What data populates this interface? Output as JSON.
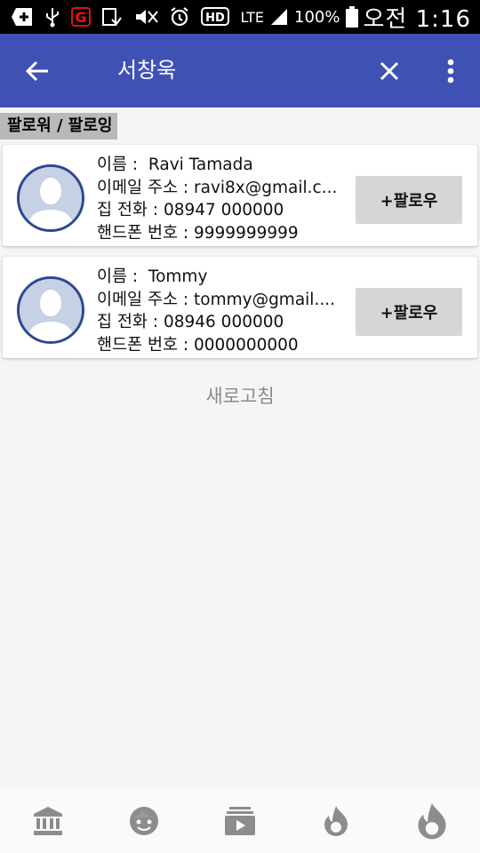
{
  "status_bar": {
    "network": "LTE",
    "battery": "100%",
    "time": "오전 1:16",
    "hd_label": "HD"
  },
  "app_bar": {
    "title": "서창욱"
  },
  "section_label": "팔로워 / 팔로잉",
  "users": [
    {
      "name_label": "이름 :",
      "name": "Ravi Tamada",
      "email_label": "이메일 주소 :",
      "email": "ravi8x@gmail.c...",
      "home_label": "집 전화 :",
      "home": "08947 000000",
      "mobile_label": "핸드폰 번호 :",
      "mobile": "9999999999",
      "button_label": "+팔로우"
    },
    {
      "name_label": "이름 :",
      "name": "Tommy",
      "email_label": "이메일 주소 :",
      "email": "tommy@gmail....",
      "home_label": "집 전화 :",
      "home": "08946 000000",
      "mobile_label": "핸드폰 번호 :",
      "mobile": "0000000000",
      "button_label": "+팔로우"
    }
  ],
  "refresh_label": "새로고침",
  "colors": {
    "app_bar": "#3f51b5",
    "avatar_border": "#2f4791",
    "button_bg": "#d6d6d6",
    "nav_icon": "#8c8c8c"
  },
  "bottom_nav": [
    "bank-icon",
    "face-icon",
    "media-icon",
    "flame-icon",
    "flame-icon"
  ]
}
